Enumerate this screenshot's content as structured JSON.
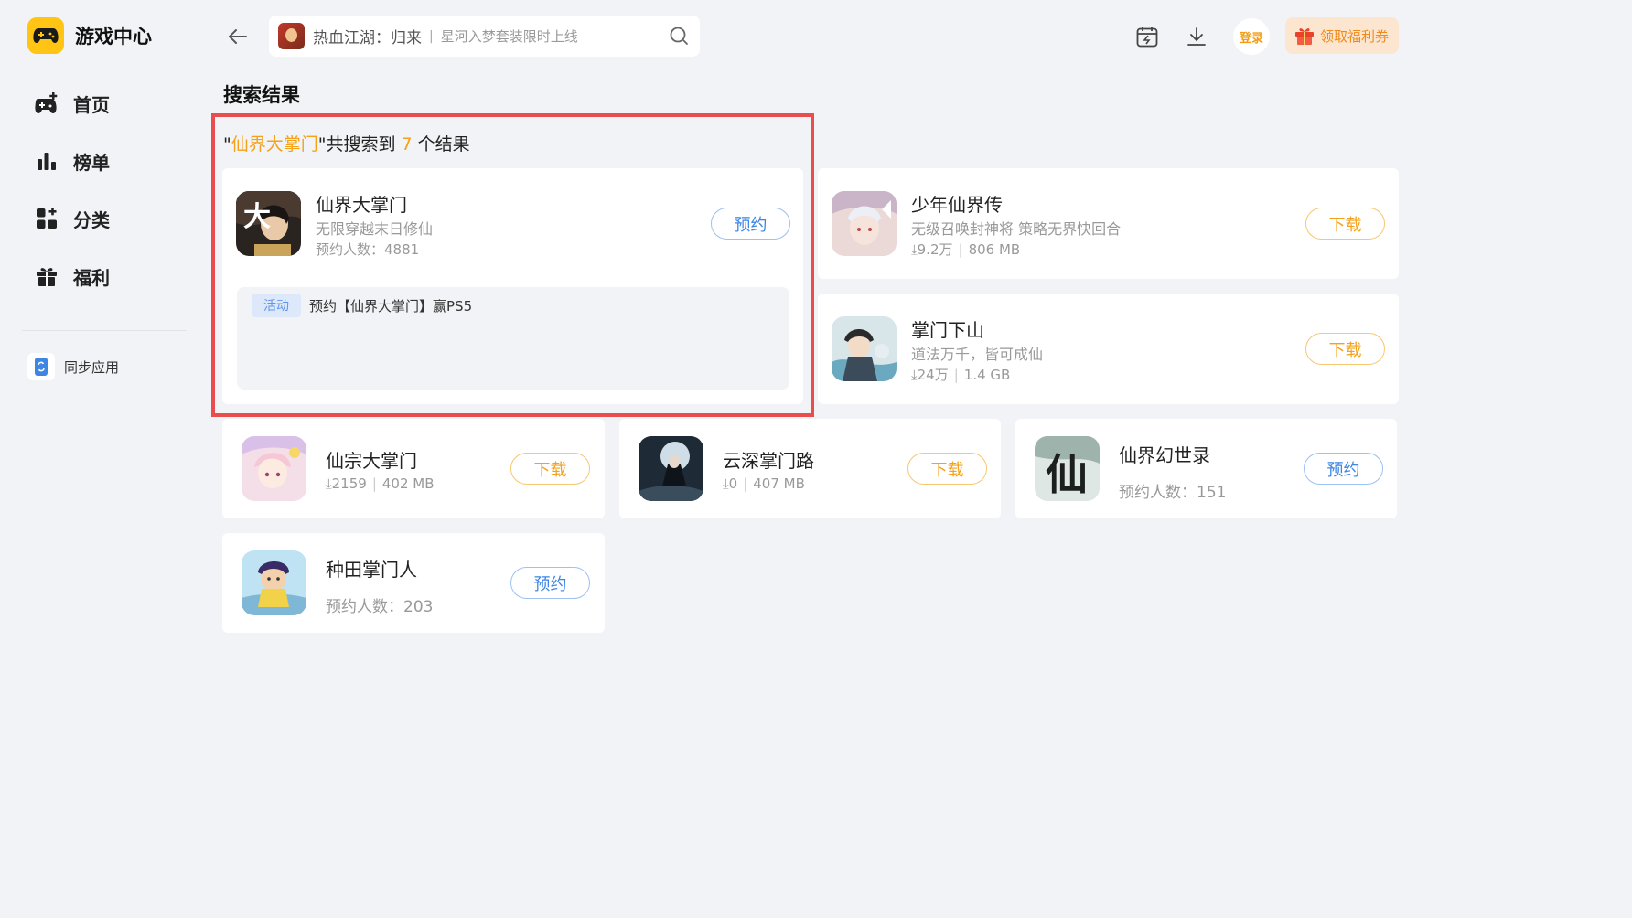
{
  "app": {
    "title": "游戏中心"
  },
  "nav": [
    {
      "label": "首页",
      "icon": "gamepad-icon"
    },
    {
      "label": "榜单",
      "icon": "bar-chart-icon"
    },
    {
      "label": "分类",
      "icon": "category-grid-icon"
    },
    {
      "label": "福利",
      "icon": "gift-icon"
    }
  ],
  "sync": {
    "label": "同步应用"
  },
  "search": {
    "game": "热血江湖：归来",
    "separator": "|",
    "tagline": "星河入梦套装限时上线"
  },
  "header": {
    "login_label": "登录",
    "coupon_label": "领取福利券"
  },
  "page": {
    "title": "搜索结果",
    "query": "仙界大掌门",
    "count_prefix": "\"",
    "count_middle": "\"共搜索到 ",
    "count": "7",
    "count_suffix": " 个结果"
  },
  "featured": {
    "name": "仙界大掌门",
    "desc": "无限穿越末日修仙",
    "meta": "预约人数：4881",
    "button": "预约",
    "activity_tag": "活动",
    "activity_text": "预约【仙界大掌门】赢PS5"
  },
  "results": [
    {
      "name": "少年仙界传",
      "desc": "无级召唤封神将 策略无界快回合",
      "downloads": "9.2万",
      "size": "806 MB",
      "button": "下载"
    },
    {
      "name": "掌门下山",
      "desc": "道法万千，皆可成仙",
      "downloads": "24万",
      "size": "1.4 GB",
      "button": "下载"
    },
    {
      "name": "仙宗大掌门",
      "downloads": "2159",
      "size": "402 MB",
      "button": "下载"
    },
    {
      "name": "云深掌门路",
      "downloads": "0",
      "size": "407 MB",
      "button": "下载"
    },
    {
      "name": "仙界幻世录",
      "meta": "预约人数：151",
      "button": "预约"
    },
    {
      "name": "种田掌门人",
      "meta": "预约人数：203",
      "button": "预约"
    }
  ],
  "colors": {
    "accent": "#f5a21a",
    "reserve_blue": "#3d86e6",
    "highlight_border": "#e94d4d",
    "logo_yellow": "#ffc414"
  }
}
